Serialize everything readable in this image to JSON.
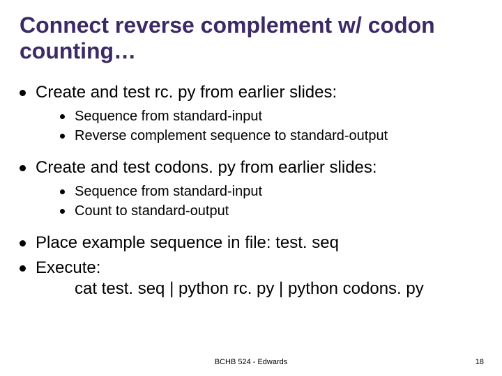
{
  "title": "Connect reverse complement w/ codon counting…",
  "bullets": [
    {
      "text": "Create and test rc. py from earlier slides:",
      "sub": [
        "Sequence from standard-input",
        "Reverse complement sequence to standard-output"
      ]
    },
    {
      "text": "Create and test codons. py from earlier slides:",
      "sub": [
        "Sequence from standard-input",
        "Count to standard-output"
      ]
    },
    {
      "text": "Place example sequence in file: test. seq",
      "sub": []
    },
    {
      "text": "Execute:",
      "extra": "cat test. seq | python rc. py | python codons. py",
      "sub": []
    }
  ],
  "footer": {
    "center": "BCHB 524 - Edwards",
    "page": "18"
  }
}
